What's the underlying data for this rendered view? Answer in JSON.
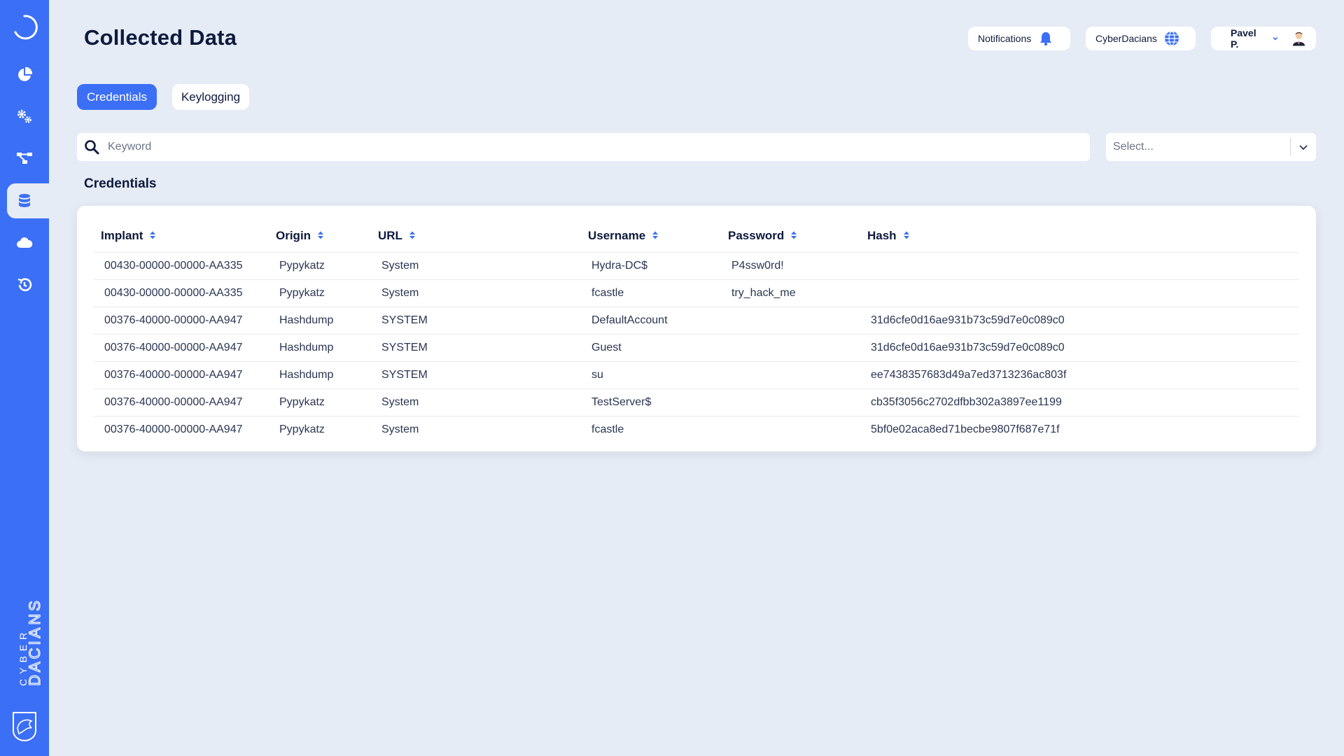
{
  "page": {
    "title": "Collected Data",
    "section_title": "Credentials"
  },
  "header": {
    "notifications_label": "Notifications",
    "org_label": "CyberDacians",
    "user_label": "Pavel P."
  },
  "tabs": [
    {
      "label": "Credentials",
      "active": true
    },
    {
      "label": "Keylogging",
      "active": false
    }
  ],
  "search": {
    "placeholder": "Keyword",
    "value": ""
  },
  "filter_select": {
    "placeholder": "Select..."
  },
  "sidebar": {
    "items": [
      {
        "icon": "dashboard-pie-icon",
        "active": false
      },
      {
        "icon": "gears-icon",
        "active": false
      },
      {
        "icon": "network-tree-icon",
        "active": false
      },
      {
        "icon": "database-icon",
        "active": true
      },
      {
        "icon": "cloud-icon",
        "active": false
      },
      {
        "icon": "history-icon",
        "active": false
      }
    ],
    "brand_line1": "CYBER",
    "brand_line2": "DACIANS"
  },
  "table": {
    "columns": [
      "Implant",
      "Origin",
      "URL",
      "Username",
      "Password",
      "Hash"
    ],
    "rows": [
      [
        "00430-00000-00000-AA335",
        "Pypykatz",
        "System",
        "Hydra-DC$",
        "P4ssw0rd!",
        ""
      ],
      [
        "00430-00000-00000-AA335",
        "Pypykatz",
        "System",
        "fcastle",
        "try_hack_me",
        ""
      ],
      [
        "00376-40000-00000-AA947",
        "Hashdump",
        "SYSTEM",
        "DefaultAccount",
        "",
        "31d6cfe0d16ae931b73c59d7e0c089c0"
      ],
      [
        "00376-40000-00000-AA947",
        "Hashdump",
        "SYSTEM",
        "Guest",
        "",
        "31d6cfe0d16ae931b73c59d7e0c089c0"
      ],
      [
        "00376-40000-00000-AA947",
        "Hashdump",
        "SYSTEM",
        "su",
        "",
        "ee7438357683d49a7ed3713236ac803f"
      ],
      [
        "00376-40000-00000-AA947",
        "Pypykatz",
        "System",
        "TestServer$",
        "",
        "cb35f3056c2702dfbb302a3897ee1199"
      ],
      [
        "00376-40000-00000-AA947",
        "Pypykatz",
        "System",
        "fcastle",
        "",
        "5bf0e02aca8ed71becbe9807f687e71f"
      ]
    ]
  },
  "colors": {
    "accent": "#3b6ff5",
    "background": "#e6ecf5",
    "text": "#0e1a3d"
  }
}
